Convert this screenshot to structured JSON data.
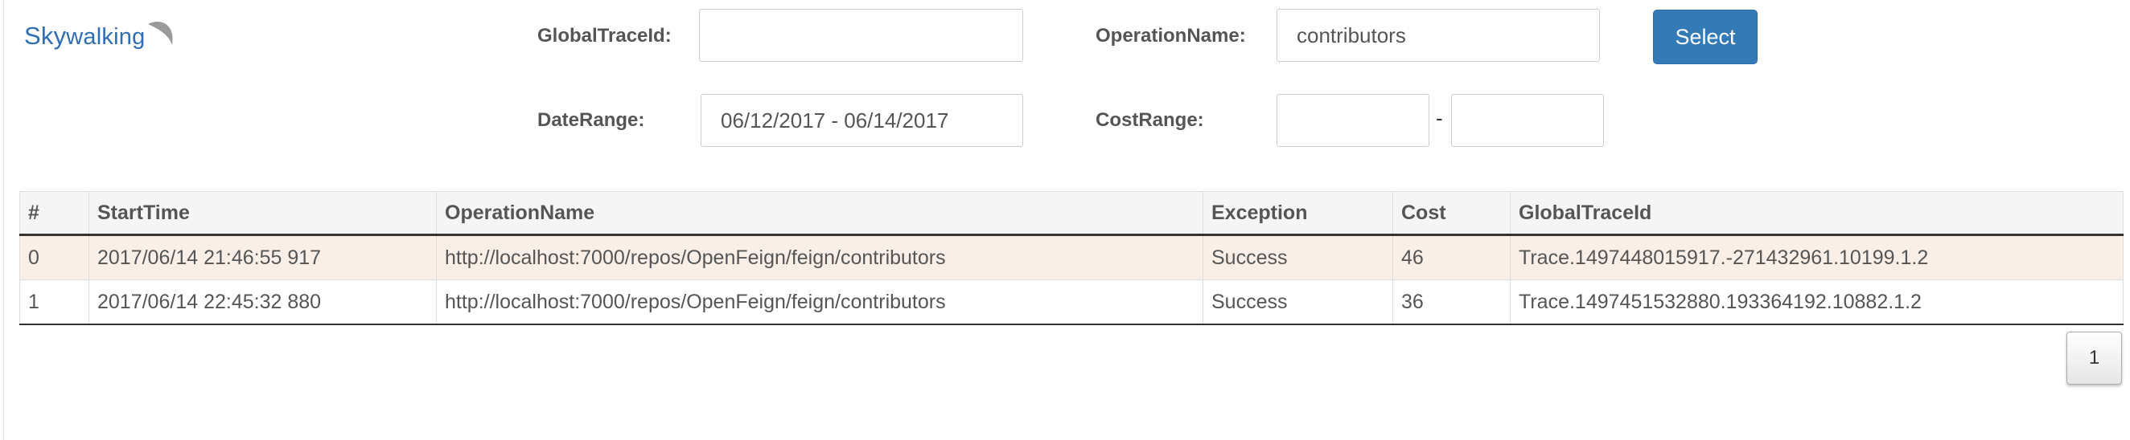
{
  "header": {
    "logo": {
      "prefix": "Sky",
      "suffix": "walking"
    }
  },
  "filters": {
    "global_trace_id": {
      "label": "GlobalTraceId:",
      "value": ""
    },
    "operation_name": {
      "label": "OperationName:",
      "value": "contributors"
    },
    "date_range": {
      "label": "DateRange:",
      "value": "06/12/2017 - 06/14/2017"
    },
    "cost_range": {
      "label": "CostRange:",
      "min_value": "",
      "separator": "-",
      "max_value": ""
    },
    "select_label": "Select"
  },
  "table": {
    "columns": [
      "#",
      "StartTime",
      "OperationName",
      "Exception",
      "Cost",
      "GlobalTraceId"
    ],
    "rows": [
      {
        "index": "0",
        "start_time": "2017/06/14 21:46:55 917",
        "operation_name": "http://localhost:7000/repos/OpenFeign/feign/contributors",
        "exception": "Success",
        "cost": "46",
        "global_trace_id": "Trace.1497448015917.-271432961.10199.1.2"
      },
      {
        "index": "1",
        "start_time": "2017/06/14 22:45:32 880",
        "operation_name": "http://localhost:7000/repos/OpenFeign/feign/contributors",
        "exception": "Success",
        "cost": "36",
        "global_trace_id": "Trace.1497451532880.193364192.10882.1.2"
      }
    ]
  },
  "pagination": {
    "pages": [
      "1"
    ]
  },
  "colors": {
    "brand": "#2f6eb5",
    "primary_button": "#337ab7",
    "highlight_row": "#f9efe6"
  }
}
